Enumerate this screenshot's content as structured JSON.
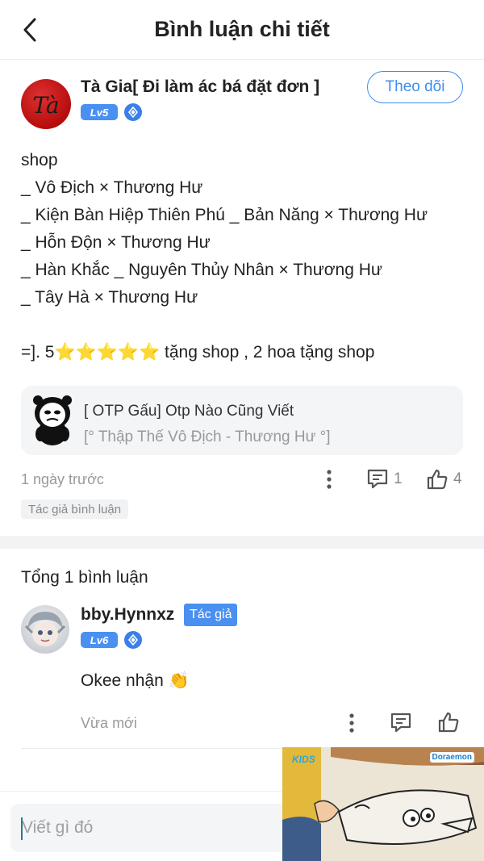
{
  "header": {
    "title": "Bình luận chi tiết"
  },
  "post": {
    "author_name": "Tà Gia[ Đi làm ác bá đặt đơn ]",
    "avatar_glyph": "Tà",
    "level": "Lv5",
    "follow_label": "Theo dõi",
    "lines": [
      "shop",
      "_ Vô Địch × Thương Hư",
      "_ Kiện Bàn Hiệp Thiên Phú _ Bản Năng × Thương Hư",
      "_ Hỗn Độn × Thương Hư",
      "_ Hàn Khắc _ Nguyên Thủy Nhân × Thương Hư",
      "_ Tây Hà × Thương Hư"
    ],
    "rating_prefix": "=]. 5",
    "stars": "⭐⭐⭐⭐⭐",
    "rating_suffix": " tặng shop , 2 hoa tặng shop",
    "time": "1 ngày trước",
    "reply_count": "1",
    "like_count": "4",
    "author_tag": "Tác giả bình luận"
  },
  "ref_card": {
    "title": "[ OTP Gấu] Otp Nào Cũng Viết",
    "subtitle": "[° Thập Thế Vô Địch - Thương Hư °]"
  },
  "replies": {
    "total_label": "Tổng 1 bình luận",
    "items": [
      {
        "name": "bby.Hynnxz",
        "author_badge": "Tác giả",
        "level": "Lv6",
        "text": "Okee nhận",
        "emoji": "👏",
        "time": "Vừa mới"
      }
    ]
  },
  "input": {
    "placeholder": "Viết gì đó"
  },
  "video": {
    "logo_left": "KIDS",
    "logo_right": "Doraemon"
  },
  "colors": {
    "accent": "#3d8ef0",
    "level_badge": "#4a90f0",
    "muted_text": "#999999"
  }
}
